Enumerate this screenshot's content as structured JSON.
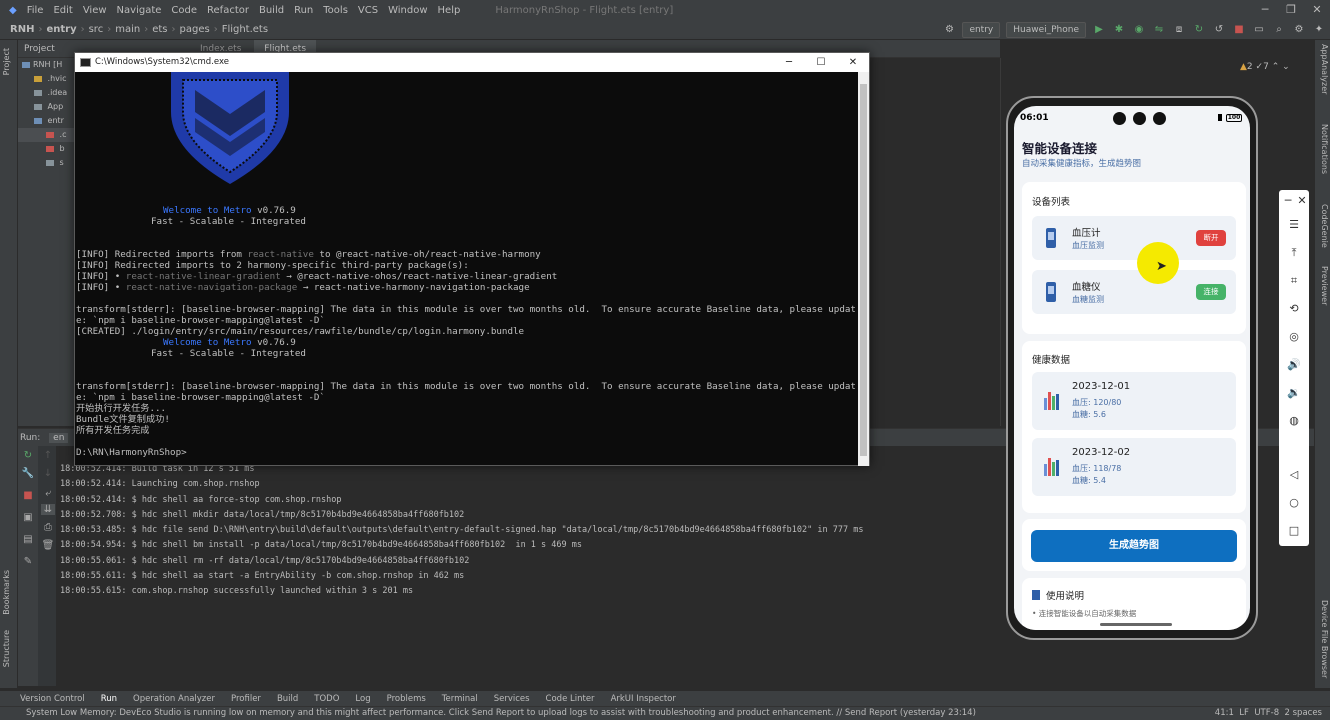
{
  "menu": [
    "File",
    "Edit",
    "View",
    "Navigate",
    "Code",
    "Refactor",
    "Build",
    "Run",
    "Tools",
    "VCS",
    "Window",
    "Help"
  ],
  "window_title": "HarmonyRnShop - Flight.ets [entry]",
  "breadcrumb": [
    "RNH",
    "entry",
    "src",
    "main",
    "ets",
    "pages",
    "Flight.ets"
  ],
  "toolbar": {
    "module": "entry",
    "device": "Huawei_Phone"
  },
  "project": {
    "header": "Project",
    "rows": [
      "RNH [H",
      "  .hvic",
      "  .idea",
      "  App",
      "  entr",
      "   .c",
      "   b",
      "   s"
    ]
  },
  "editor": {
    "tabs": [
      "Index.ets",
      "Flight.ets"
    ],
    "warn_count": "2",
    "weak_count": "7"
  },
  "cmd": {
    "title": "C:\\Windows\\System32\\cmd.exe",
    "welcome_a": "Welcome to ",
    "welcome_b": "Metro",
    "welcome_c": " v0.76.9",
    "tagline": "Fast - Scalable - Integrated",
    "l1a": "[INFO] Redirected imports from ",
    "l1b": "react-native",
    "l1c": " to @react-native-oh/react-native-harmony",
    "l2": "[INFO] Redirected imports to 2 harmony-specific third-party package(s):",
    "l3a": "[INFO] • ",
    "l3b": "react-native-linear-gradient",
    "l3c": " → @react-native-ohos/react-native-linear-gradient",
    "l4a": "[INFO] • ",
    "l4b": "react-native-navigation-package",
    "l4c": " → react-native-harmony-navigation-package",
    "l5": "transform[stderr]: [baseline-browser-mapping] The data in this module is over two months old.  To ensure accurate Baseline data, please updat",
    "l6": "e: `npm i baseline-browser-mapping@latest -D`",
    "l7": "[CREATED] ./login/entry/src/main/resources/rawfile/bundle/cp/login.harmony.bundle",
    "l8": "transform[stderr]: [baseline-browser-mapping] The data in this module is over two months old.  To ensure accurate Baseline data, please updat",
    "l9": "e: `npm i baseline-browser-mapping@latest -D`",
    "l10": "开始执行开发任务...",
    "l11": "Bundle文件复制成功!",
    "l12": "所有开发任务完成",
    "prompt": "D:\\RN\\HarmonyRnShop>"
  },
  "run": {
    "label": "Run:",
    "tab": "en",
    "log": [
      "18:00:52.414: Build task in 12 s 51 ms",
      "18:00:52.414: Launching com.shop.rnshop",
      "18:00:52.414: $ hdc shell aa force-stop com.shop.rnshop",
      "18:00:52.708: $ hdc shell mkdir data/local/tmp/8c5170b4bd9e4664858ba4ff680fb102",
      "18:00:53.485: $ hdc file send D:\\RNH\\entry\\build\\default\\outputs\\default\\entry-default-signed.hap \"data/local/tmp/8c5170b4bd9e4664858ba4ff680fb102\" in 777 ms",
      "18:00:54.954: $ hdc shell bm install -p data/local/tmp/8c5170b4bd9e4664858ba4ff680fb102  in 1 s 469 ms",
      "18:00:55.061: $ hdc shell rm -rf data/local/tmp/8c5170b4bd9e4664858ba4ff680fb102",
      "18:00:55.611: $ hdc shell aa start -a EntryAbility -b com.shop.rnshop in 462 ms",
      "18:00:55.615: com.shop.rnshop successfully launched within 3 s 201 ms"
    ]
  },
  "phone": {
    "time": "06:01",
    "battery": "100",
    "title": "智能设备连接",
    "subtitle": "自动采集健康指标，生成趋势图",
    "devices_title": "设备列表",
    "devices": [
      {
        "name": "血压计",
        "sub": "血压监测",
        "action": "断开",
        "color": "#e0423e"
      },
      {
        "name": "血糖仪",
        "sub": "血糖监测",
        "action": "连接",
        "color": "#46b368"
      }
    ],
    "health_title": "健康数据",
    "records": [
      {
        "date": "2023-12-01",
        "bp": "血压: 120/80",
        "bs": "血糖: 5.6"
      },
      {
        "date": "2023-12-02",
        "bp": "血压: 118/78",
        "bs": "血糖: 5.4"
      }
    ],
    "generate": "生成趋势图",
    "help_title": "使用说明",
    "help_item": "• 连接智能设备以自动采集数据"
  },
  "left_tabs": [
    "Project",
    "Bookmarks",
    "Structure"
  ],
  "right_tabs": [
    "AppAnalyzer",
    "Notifications",
    "CodeGenie",
    "Previewer",
    "Device File Browser"
  ],
  "bottom_tabs": [
    "Version Control",
    "Run",
    "Operation Analyzer",
    "Profiler",
    "Build",
    "TODO",
    "Log",
    "Problems",
    "Terminal",
    "Services",
    "Code Linter",
    "ArkUI Inspector"
  ],
  "statusbar": {
    "message": "System Low Memory: DevEco Studio is running low on memory and this might affect performance. Click Send Report to upload logs to assist with troubleshooting and product enhancement. // Send Report (yesterday 23:14)",
    "pos": "41:1",
    "ending": "LF",
    "encoding": "UTF-8",
    "indent": "2 spaces"
  }
}
